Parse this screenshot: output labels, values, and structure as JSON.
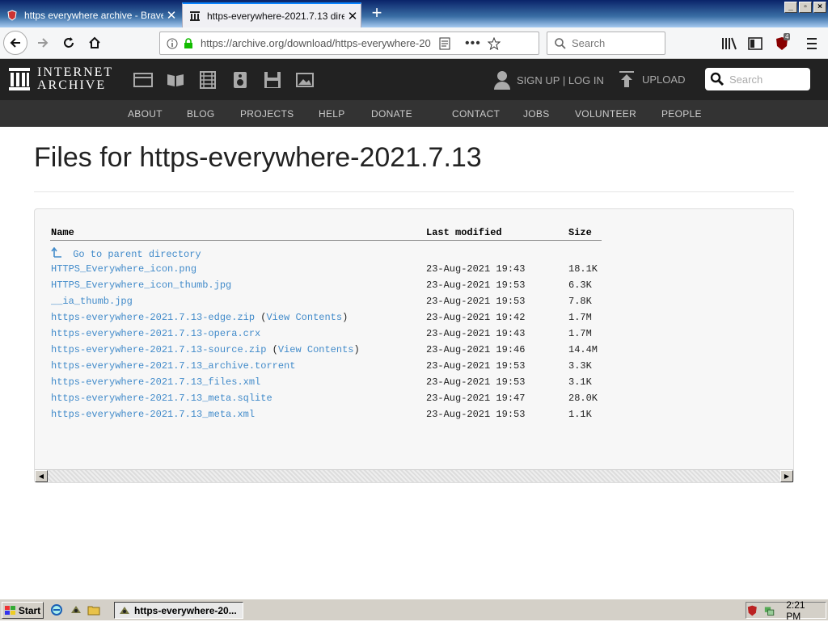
{
  "browser": {
    "tabs": [
      {
        "title": "https everywhere archive - Brave",
        "active": false
      },
      {
        "title": "https-everywhere-2021.7.13 dire",
        "active": true
      }
    ],
    "url": "https://archive.org/download/https-everywhere-20",
    "search_placeholder": "Search",
    "badge_count": "4"
  },
  "ia_header": {
    "logo_line1": "INTERNET",
    "logo_line2": "ARCHIVE",
    "signup_login": "SIGN UP | LOG IN",
    "upload": "UPLOAD",
    "search_placeholder": "Search",
    "nav": [
      "ABOUT",
      "BLOG",
      "PROJECTS",
      "HELP",
      "DONATE",
      "CONTACT",
      "JOBS",
      "VOLUNTEER",
      "PEOPLE"
    ]
  },
  "page": {
    "title": "Files for https-everywhere-2021.7.13",
    "columns": {
      "name": "Name",
      "modified": "Last modified",
      "size": "Size"
    },
    "parent_link": "Go to parent directory",
    "files": [
      {
        "name": "HTTPS_Everywhere_icon.png",
        "extra": "",
        "modified": "23-Aug-2021 19:43",
        "size": "18.1K"
      },
      {
        "name": "HTTPS_Everywhere_icon_thumb.jpg",
        "extra": "",
        "modified": "23-Aug-2021 19:53",
        "size": "6.3K"
      },
      {
        "name": "__ia_thumb.jpg",
        "extra": "",
        "modified": "23-Aug-2021 19:53",
        "size": "7.8K"
      },
      {
        "name": "https-everywhere-2021.7.13-edge.zip",
        "extra": "View Contents",
        "modified": "23-Aug-2021 19:42",
        "size": "1.7M"
      },
      {
        "name": "https-everywhere-2021.7.13-opera.crx",
        "extra": "",
        "modified": "23-Aug-2021 19:43",
        "size": "1.7M"
      },
      {
        "name": "https-everywhere-2021.7.13-source.zip",
        "extra": "View Contents",
        "modified": "23-Aug-2021 19:46",
        "size": "14.4M"
      },
      {
        "name": "https-everywhere-2021.7.13_archive.torrent",
        "extra": "",
        "modified": "23-Aug-2021 19:53",
        "size": "3.3K"
      },
      {
        "name": "https-everywhere-2021.7.13_files.xml",
        "extra": "",
        "modified": "23-Aug-2021 19:53",
        "size": "3.1K"
      },
      {
        "name": "https-everywhere-2021.7.13_meta.sqlite",
        "extra": "",
        "modified": "23-Aug-2021 19:47",
        "size": "28.0K"
      },
      {
        "name": "https-everywhere-2021.7.13_meta.xml",
        "extra": "",
        "modified": "23-Aug-2021 19:53",
        "size": "1.1K"
      }
    ]
  },
  "taskbar": {
    "start": "Start",
    "window": "https-everywhere-20...",
    "clock": "2:21 PM"
  },
  "colors": {
    "link": "#428bca",
    "ia_header": "#222222",
    "ia_nav": "#333333",
    "donate_heart": "#e11"
  }
}
